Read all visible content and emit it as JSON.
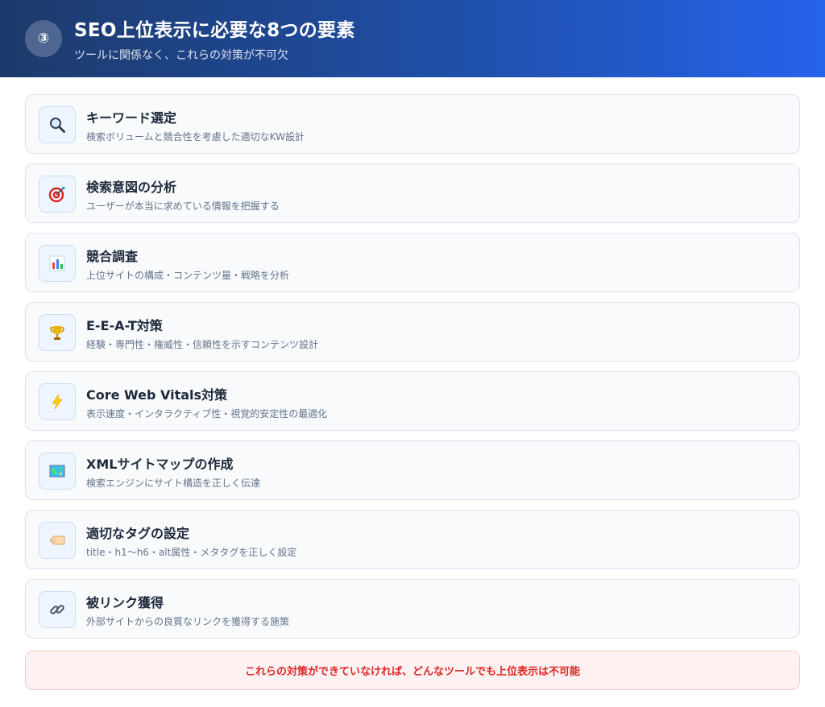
{
  "header": {
    "step": "③",
    "title": "SEO上位表示に必要な8つの要素",
    "subtitle": "ツールに関係なく、これらの対策が不可欠",
    "gradient_start": "#1e3a6b",
    "gradient_end": "#2563eb"
  },
  "items": [
    {
      "icon": "magnifier-icon",
      "title": "キーワード選定",
      "desc": "検索ボリュームと競合性を考慮した適切なKW設計"
    },
    {
      "icon": "target-icon",
      "title": "検索意図の分析",
      "desc": "ユーザーが本当に求めている情報を把握する"
    },
    {
      "icon": "bar-chart-icon",
      "title": "競合調査",
      "desc": "上位サイトの構成・コンテンツ量・戦略を分析"
    },
    {
      "icon": "trophy-icon",
      "title": "E-E-A-T対策",
      "desc": "経験・専門性・権威性・信頼性を示すコンテンツ設計"
    },
    {
      "icon": "lightning-icon",
      "title": "Core Web Vitals対策",
      "desc": "表示速度・インタラクティブ性・視覚的安定性の最適化"
    },
    {
      "icon": "map-icon",
      "title": "XMLサイトマップの作成",
      "desc": "検索エンジンにサイト構造を正しく伝達"
    },
    {
      "icon": "tag-icon",
      "title": "適切なタグの設定",
      "desc": "title・h1〜h6・alt属性・メタタグを正しく設定"
    },
    {
      "icon": "link-icon",
      "title": "被リンク獲得",
      "desc": "外部サイトからの良質なリンクを獲得する施策"
    }
  ],
  "notice": {
    "text": "これらの対策ができていなければ、どんなツールでも上位表示は不可能",
    "color": "#dc2626"
  }
}
